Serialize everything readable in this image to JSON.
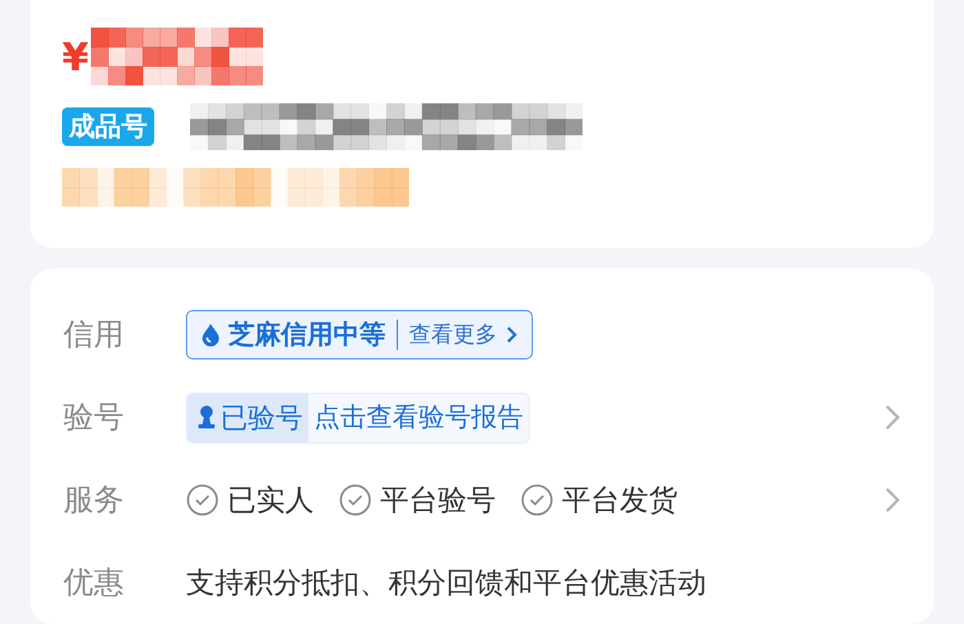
{
  "price": {
    "currency": "¥"
  },
  "product_tag": "成品号",
  "details": [
    {
      "kind": "credit",
      "label": "信用",
      "tag": "芝麻信用中等",
      "link": "查看更多",
      "chevron": false
    },
    {
      "kind": "verify",
      "label": "验号",
      "status": "已验号",
      "link": "点击查看验号报告",
      "chevron": true
    },
    {
      "kind": "services",
      "label": "服务",
      "items": [
        "已实人",
        "平台验号",
        "平台发货"
      ],
      "chevron": true
    },
    {
      "kind": "text",
      "label": "优惠",
      "text": "支持积分抵扣、积分回馈和平台优惠活动",
      "chevron": false
    }
  ]
}
